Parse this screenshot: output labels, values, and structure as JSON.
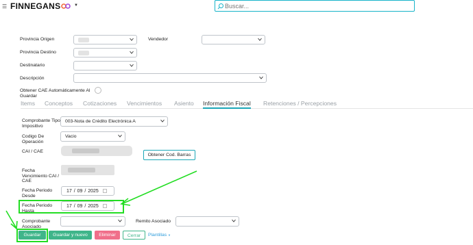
{
  "header": {
    "logo_text": "FINNEGANS",
    "search_placeholder": "Buscar..."
  },
  "form": {
    "provincia_origen_label": "Provincia Origen",
    "vendedor_label": "Vendedor",
    "provincia_destino_label": "Provincia Destino",
    "destinatario_label": "Destinatario",
    "descripcion_label": "Descripción",
    "cae_auto_label_line1": "Obtener CAE Automáticamente Al",
    "cae_auto_label_line2": "Guardar"
  },
  "tabs": [
    {
      "label": "Items"
    },
    {
      "label": "Conceptos"
    },
    {
      "label": "Cotizaciones"
    },
    {
      "label": "Vencimientos"
    },
    {
      "label": "Asiento"
    },
    {
      "label": "Información Fiscal",
      "active": true
    },
    {
      "label": "Retenciones / Percepciones"
    }
  ],
  "fiscal": {
    "comprobante_tipo_label_line1": "Comprobante Tipo",
    "comprobante_tipo_label_line2": "Impositivo",
    "comprobante_tipo_value": "003-Nota de Crédito Electrónica A",
    "codigo_operacion_label_line1": "Codigo De",
    "codigo_operacion_label_line2": "Operación",
    "codigo_operacion_value": "Vacio",
    "cai_cae_label": "CAI / CAE",
    "obtener_barras_label": "Obtener Cod. Barras",
    "fecha_venc_label_line1": "Fecha",
    "fecha_venc_label_line2": "Vencimiento CAI /",
    "fecha_venc_label_line3": "CAE",
    "fecha_desde_label_line1": "Fecha Periodo",
    "fecha_desde_label_line2": "Desde",
    "fecha_desde_value": "17 / 09 / 2025",
    "fecha_hasta_label_line1": "Fecha Periodo",
    "fecha_hasta_label_line2": "Hasta",
    "fecha_hasta_value": "17 / 09 / 2025",
    "comprobante_asociado_label_line1": "Comprobante",
    "comprobante_asociado_label_line2": "Asociado",
    "remito_asociado_label": "Remito Asociado"
  },
  "actions": {
    "guardar": "Guardar",
    "guardar_y_nuevo": "Guardar y nuevo",
    "eliminar": "Eliminar",
    "cerrar": "Cerrar",
    "plantillas": "Plantillas"
  },
  "colors": {
    "accent": "#1aa6b7",
    "save": "#3fb58a",
    "delete": "#f06f8a",
    "highlight": "#22dd22"
  }
}
